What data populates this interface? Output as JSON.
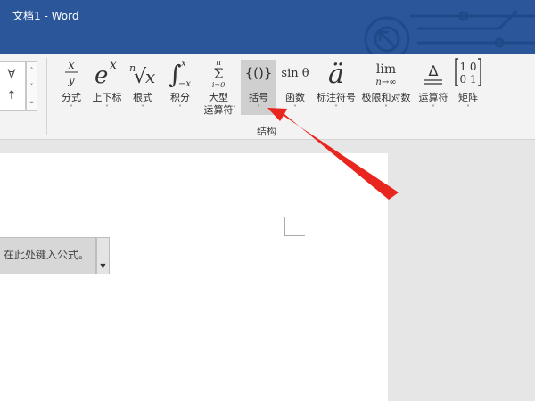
{
  "window": {
    "title": "文档1  -  Word"
  },
  "ribbon": {
    "symbol_gallery": [
      "∀",
      "↑"
    ],
    "gallery_scroll": [
      "˄",
      "˅",
      "⩡"
    ],
    "group_label": "结构",
    "commands": [
      {
        "label": "分式",
        "icon": "fraction-icon"
      },
      {
        "label": "上下标",
        "icon": "script-icon"
      },
      {
        "label": "根式",
        "icon": "radical-icon"
      },
      {
        "label": "积分",
        "icon": "integral-icon"
      },
      {
        "label": "大型",
        "label2": "运算符",
        "icon": "large-operator-icon"
      },
      {
        "label": "括号",
        "icon": "bracket-icon"
      },
      {
        "label": "函数",
        "icon": "function-icon"
      },
      {
        "label": "标注符号",
        "icon": "accent-icon"
      },
      {
        "label": "极限和对数",
        "icon": "limit-icon"
      },
      {
        "label": "运算符",
        "icon": "operator-icon"
      },
      {
        "label": "矩阵",
        "icon": "matrix-icon"
      }
    ],
    "icon_text": {
      "fraction_num": "x",
      "fraction_den": "y",
      "script_base": "e",
      "script_sup": "x",
      "radical_index": "n",
      "radical_sign": "√",
      "radical_body": "x",
      "integral_sign": "∫",
      "integral_upper": "x",
      "integral_lower": "−x",
      "sum_upper": "n",
      "sum_sign": "Σ",
      "sum_lower": "i=0",
      "bracket": "{()}",
      "function": "sin θ",
      "accent": "ä",
      "limit_top": "lim",
      "limit_bottom": "n→∞",
      "operator_sign": "Δ",
      "operator_base": "=",
      "matrix_row1": "1 0",
      "matrix_row2": "0 1"
    },
    "selected": "括号"
  },
  "document": {
    "equation_placeholder": "在此处键入公式。"
  }
}
